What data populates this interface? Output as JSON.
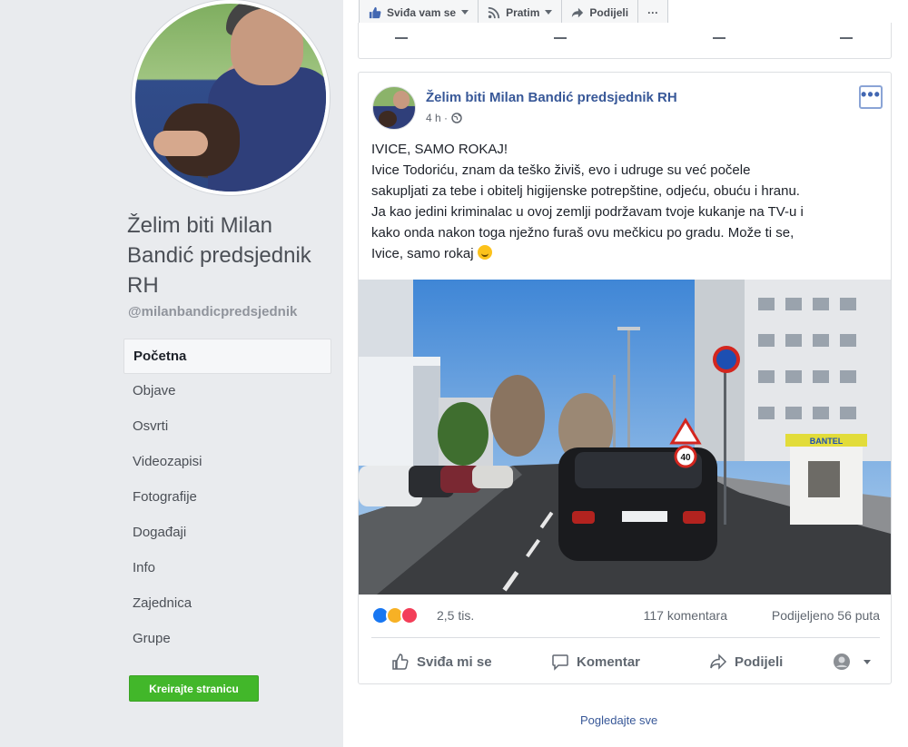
{
  "sidebar": {
    "page_name": "Želim biti Milan Bandić predsjednik RH",
    "handle": "@milanbandicpredsjednik",
    "nav": [
      {
        "label": "Početna"
      },
      {
        "label": "Objave"
      },
      {
        "label": "Osvrti"
      },
      {
        "label": "Videozapisi"
      },
      {
        "label": "Fotografije"
      },
      {
        "label": "Događaji"
      },
      {
        "label": "Info"
      },
      {
        "label": "Zajednica"
      },
      {
        "label": "Grupe"
      }
    ],
    "create_page_label": "Kreirajte stranicu"
  },
  "topbar": {
    "like_label": "Sviđa vam se",
    "follow_label": "Pratim",
    "share_label": "Podijeli",
    "more_label": "···"
  },
  "post": {
    "author": "Želim biti Milan Bandić predsjednik RH",
    "time": "4 h ·",
    "menu_label": "•••",
    "text_lines": [
      "IVICE, SAMO ROKAJ!",
      "Ivice Todoriću, znam da teško živiš, evo i udruge su već počele",
      "sakupljati za tebe i obitelj higijenske potrepštine, odjeću, obuću i hranu.",
      "Ja kao jedini kriminalac u ovoj zemlji podržavam tvoje kukanje na TV-u i",
      "kako onda nakon toga nježno furaš ovu mečkicu po gradu. Može ti se,",
      "Ivice, samo rokaj"
    ],
    "image_texts": {
      "sign_speed": "40",
      "store_sign": "BANTEL"
    },
    "reactions_count": "2,5 tis.",
    "comments_count": "117 komentara",
    "shares_count": "Podijeljeno 56 puta",
    "actions": {
      "like": "Sviđa mi se",
      "comment": "Komentar",
      "share": "Podijeli"
    }
  },
  "see_all_label": "Pogledajte sve",
  "colors": {
    "link_blue": "#385898",
    "create_green": "#42b72a",
    "background": "#e9ebee"
  }
}
